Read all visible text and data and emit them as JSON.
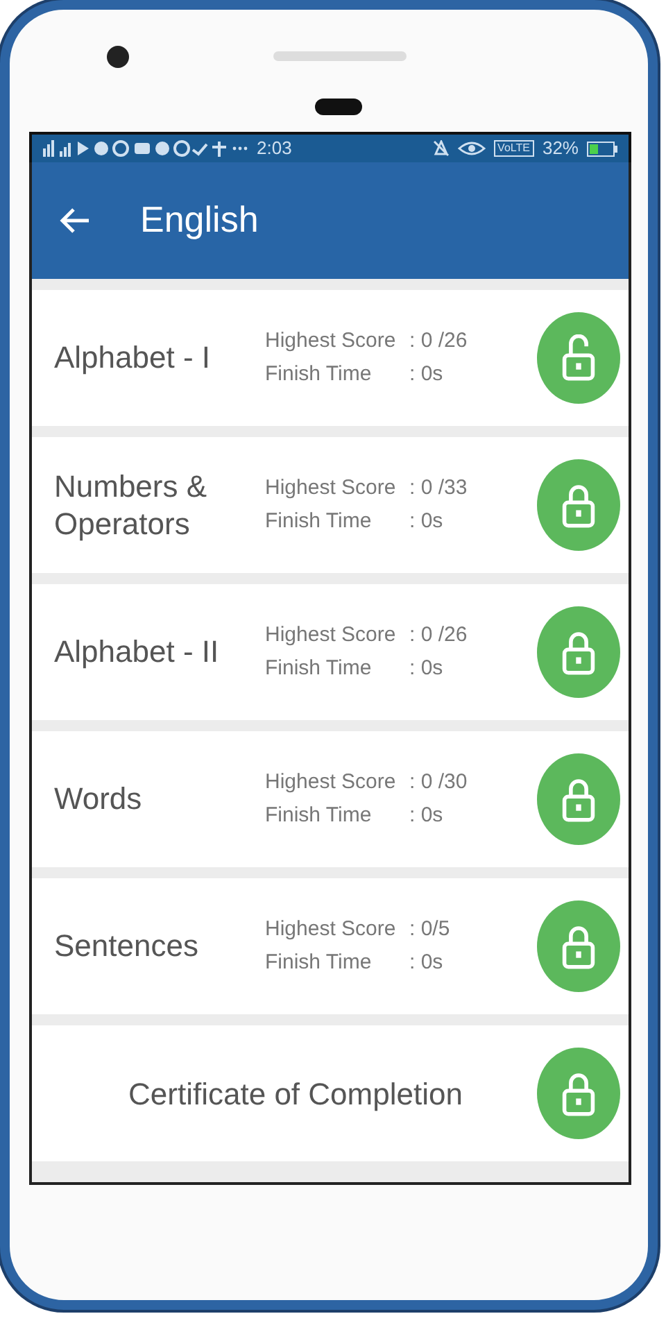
{
  "status_bar": {
    "time": "2:03",
    "volte": "VoLTE",
    "battery": "32%"
  },
  "app_bar": {
    "title": "English"
  },
  "levels": [
    {
      "kind": "level",
      "title": "Alphabet - I",
      "score_label": "Highest Score",
      "score": ": 0 /26",
      "time_label": "Finish Time",
      "time": ": 0s",
      "unlocked": true
    },
    {
      "kind": "level",
      "title": "Numbers & Operators",
      "score_label": "Highest Score",
      "score": ": 0 /33",
      "time_label": "Finish Time",
      "time": ": 0s",
      "unlocked": false
    },
    {
      "kind": "level",
      "title": "Alphabet - II",
      "score_label": "Highest Score",
      "score": ": 0 /26",
      "time_label": "Finish Time",
      "time": ": 0s",
      "unlocked": false
    },
    {
      "kind": "level",
      "title": "Words",
      "score_label": "Highest Score",
      "score": ": 0 /30",
      "time_label": "Finish Time",
      "time": ": 0s",
      "unlocked": false
    },
    {
      "kind": "level",
      "title": "Sentences",
      "score_label": "Highest Score",
      "score": ": 0/5",
      "time_label": "Finish Time",
      "time": ": 0s",
      "unlocked": false
    },
    {
      "kind": "certificate",
      "title": "Certificate of Completion",
      "unlocked": false
    }
  ]
}
